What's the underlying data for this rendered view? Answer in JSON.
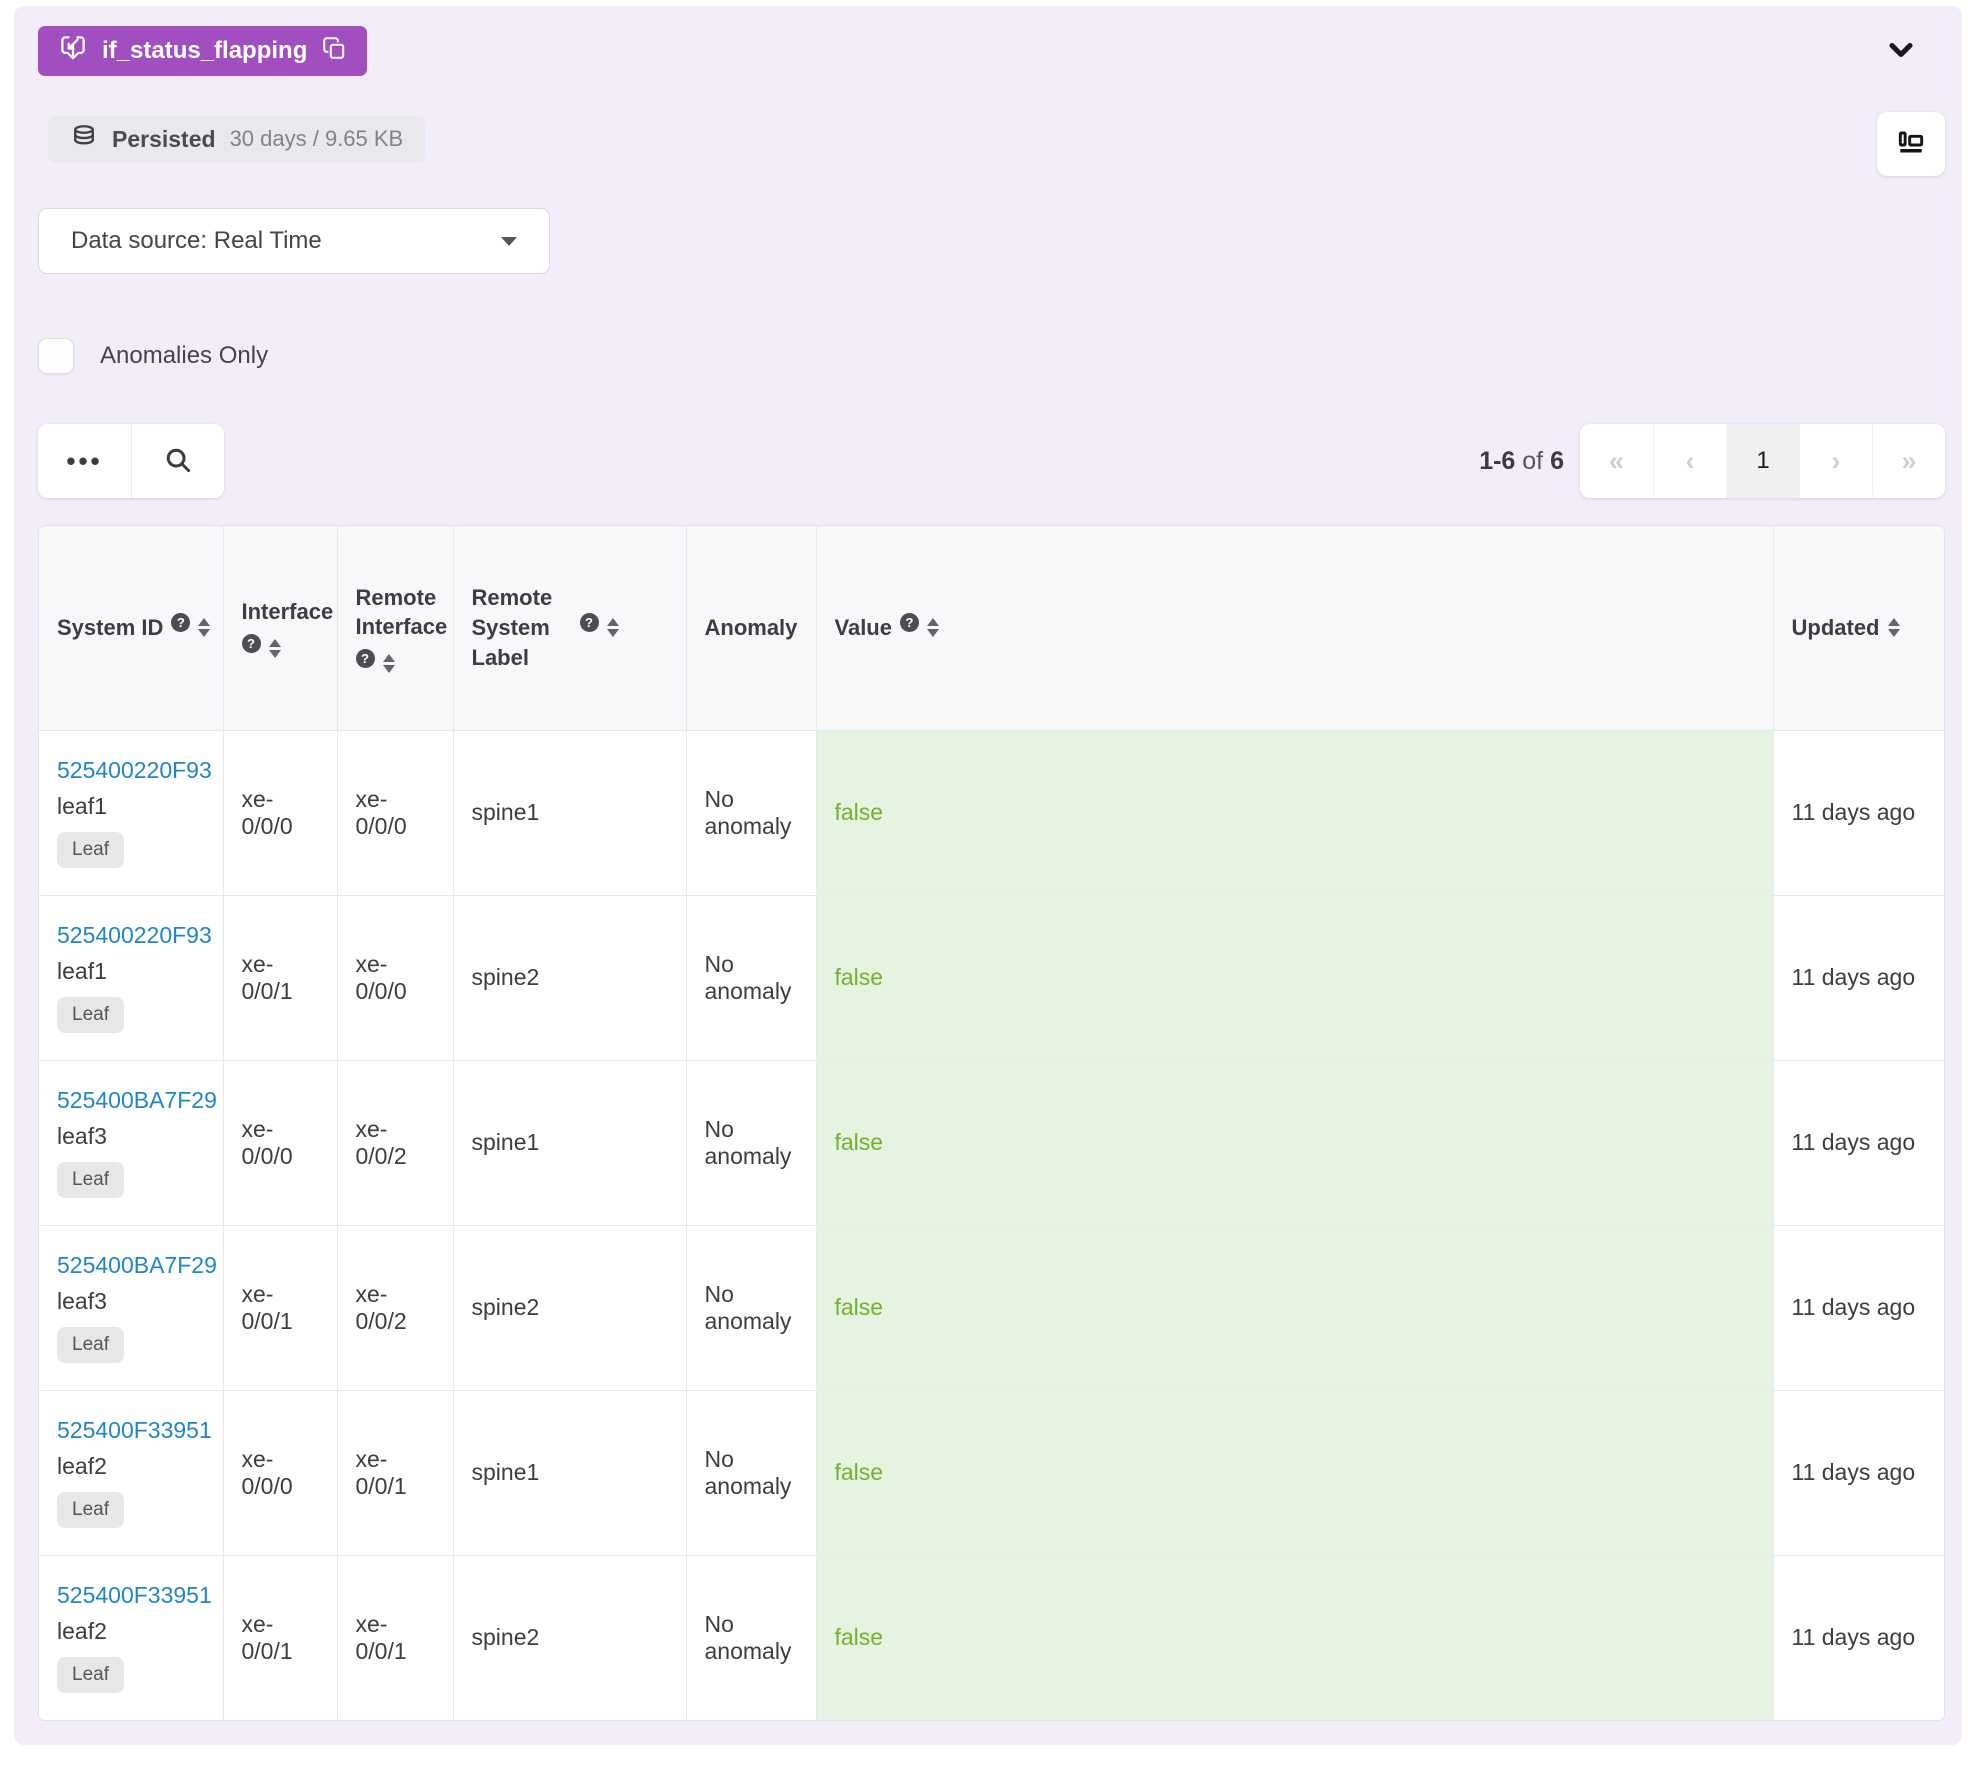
{
  "icons": {
    "more": "•••",
    "help": "?"
  },
  "colors": {
    "accent-purple": "#a14fc0",
    "link-blue": "#2086c7",
    "value-green": "#72b32e",
    "value-bg": "#e5f3e0",
    "panel-bg": "#f2edf8"
  },
  "probe": {
    "name": "if_status_flapping"
  },
  "persisted": {
    "label": "Persisted",
    "detail": "30 days / 9.65 KB"
  },
  "data_source": {
    "value": "Data source: Real Time"
  },
  "anomalies_only": {
    "label": "Anomalies Only",
    "checked": false
  },
  "pagination": {
    "summary": {
      "range": "1-6",
      "of": "of",
      "total": "6"
    },
    "buttons": [
      {
        "name": "first-page",
        "label": "«",
        "state": "disabled"
      },
      {
        "name": "previous-page",
        "label": "‹",
        "state": "disabled"
      },
      {
        "name": "page-1",
        "label": "1",
        "state": "active"
      },
      {
        "name": "next-page",
        "label": "›",
        "state": "disabled"
      },
      {
        "name": "last-page",
        "label": "»",
        "state": "disabled"
      }
    ]
  },
  "table": {
    "columns": [
      {
        "label": "System ID",
        "help": true,
        "sortable": true
      },
      {
        "label": "Interface",
        "help": true,
        "sortable": true
      },
      {
        "label": "Remote Interface",
        "help": true,
        "sortable": true
      },
      {
        "label": "Remote System Label",
        "help": true,
        "sortable": true
      },
      {
        "label": "Anomaly",
        "help": false,
        "sortable": false
      },
      {
        "label": "Value",
        "help": true,
        "sortable": true
      },
      {
        "label": "Updated",
        "help": false,
        "sortable": true
      }
    ],
    "rows": [
      {
        "system_id": "525400220F93",
        "hostname": "leaf1",
        "role": "Leaf",
        "interface": "xe-0/0/0",
        "remote_interface": "xe-0/0/0",
        "remote_system": "spine1",
        "anomaly": "No anomaly",
        "value": "false",
        "updated": "11 days ago"
      },
      {
        "system_id": "525400220F93",
        "hostname": "leaf1",
        "role": "Leaf",
        "interface": "xe-0/0/1",
        "remote_interface": "xe-0/0/0",
        "remote_system": "spine2",
        "anomaly": "No anomaly",
        "value": "false",
        "updated": "11 days ago"
      },
      {
        "system_id": "525400BA7F29",
        "hostname": "leaf3",
        "role": "Leaf",
        "interface": "xe-0/0/0",
        "remote_interface": "xe-0/0/2",
        "remote_system": "spine1",
        "anomaly": "No anomaly",
        "value": "false",
        "updated": "11 days ago"
      },
      {
        "system_id": "525400BA7F29",
        "hostname": "leaf3",
        "role": "Leaf",
        "interface": "xe-0/0/1",
        "remote_interface": "xe-0/0/2",
        "remote_system": "spine2",
        "anomaly": "No anomaly",
        "value": "false",
        "updated": "11 days ago"
      },
      {
        "system_id": "525400F33951",
        "hostname": "leaf2",
        "role": "Leaf",
        "interface": "xe-0/0/0",
        "remote_interface": "xe-0/0/1",
        "remote_system": "spine1",
        "anomaly": "No anomaly",
        "value": "false",
        "updated": "11 days ago"
      },
      {
        "system_id": "525400F33951",
        "hostname": "leaf2",
        "role": "Leaf",
        "interface": "xe-0/0/1",
        "remote_interface": "xe-0/0/1",
        "remote_system": "spine2",
        "anomaly": "No anomaly",
        "value": "false",
        "updated": "11 days ago"
      }
    ]
  }
}
